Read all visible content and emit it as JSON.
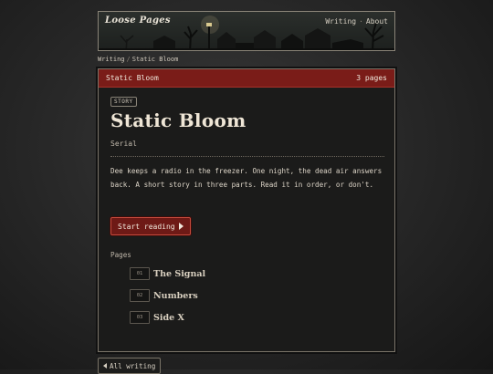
{
  "header": {
    "site_title": "Loose Pages",
    "nav": [
      "Writing",
      "About"
    ]
  },
  "breadcrumb": {
    "root": "Writing",
    "current": "Static Bloom"
  },
  "card": {
    "bar_title": "Static Bloom",
    "page_count": "3 pages",
    "tag": "STORY",
    "title": "Static Bloom",
    "subtitle": "Serial",
    "description": "Dee keeps a radio in the freezer. One night, the dead air answers back. A short story in three parts. Read it in order, or don't.",
    "start_label": "Start reading",
    "pages_label": "Pages",
    "pages": [
      {
        "num": "01",
        "name": "The Signal"
      },
      {
        "num": "02",
        "name": "Numbers"
      },
      {
        "num": "03",
        "name": "Side X"
      }
    ]
  },
  "footer": {
    "back_label": "All writing"
  },
  "colors": {
    "accent_red": "#7a1c18",
    "button_border": "#c44a3c",
    "background": "#2a2a2a"
  }
}
